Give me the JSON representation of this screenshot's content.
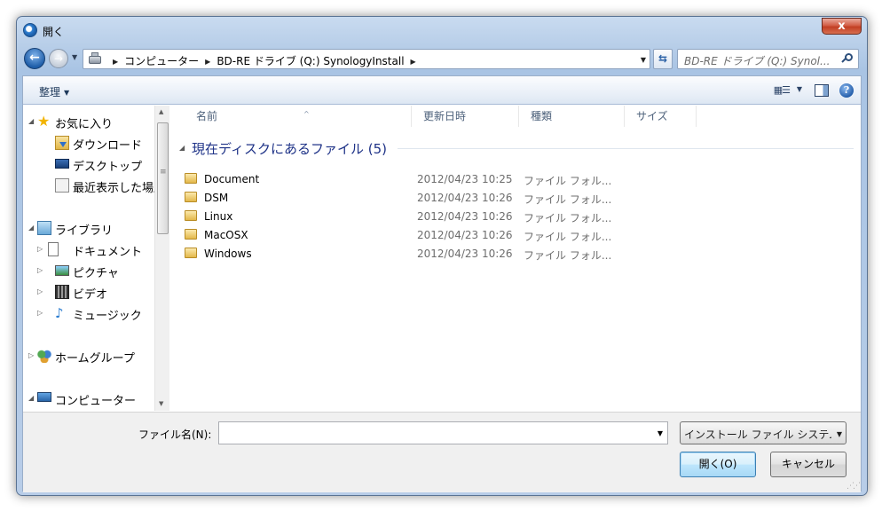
{
  "window": {
    "title": "開く",
    "close_label": "x"
  },
  "nav": {
    "back_label": "←",
    "forward_label": "→",
    "breadcrumbs": [
      "コンピューター",
      "BD-RE ドライブ (Q:) SynologyInstall"
    ],
    "search_placeholder": "BD-RE ドライブ (Q:) Synol..."
  },
  "toolbar": {
    "organize_label": "整理"
  },
  "navpane": {
    "items": [
      {
        "label": "お気に入り",
        "icon": "star-icon"
      },
      {
        "label": "ダウンロード",
        "icon": "downloads-icon"
      },
      {
        "label": "デスクトップ",
        "icon": "desktop-icon"
      },
      {
        "label": "最近表示した場所",
        "icon": "recent-places-icon"
      },
      {
        "label": "ライブラリ",
        "icon": "libraries-icon"
      },
      {
        "label": "ドキュメント",
        "icon": "documents-icon"
      },
      {
        "label": "ピクチャ",
        "icon": "pictures-icon"
      },
      {
        "label": "ビデオ",
        "icon": "videos-icon"
      },
      {
        "label": "ミュージック",
        "icon": "music-icon"
      },
      {
        "label": "ホームグループ",
        "icon": "homegroup-icon"
      },
      {
        "label": "コンピューター",
        "icon": "computer-icon"
      }
    ]
  },
  "filelist": {
    "columns": [
      "名前",
      "更新日時",
      "種類",
      "サイズ"
    ],
    "group_label": "現在ディスクにあるファイル (5)",
    "rows": [
      {
        "name": "Document",
        "date": "2012/04/23 10:25",
        "type": "ファイル フォル..."
      },
      {
        "name": "DSM",
        "date": "2012/04/23 10:26",
        "type": "ファイル フォル..."
      },
      {
        "name": "Linux",
        "date": "2012/04/23 10:26",
        "type": "ファイル フォル..."
      },
      {
        "name": "MacOSX",
        "date": "2012/04/23 10:26",
        "type": "ファイル フォル..."
      },
      {
        "name": "Windows",
        "date": "2012/04/23 10:26",
        "type": "ファイル フォル..."
      }
    ]
  },
  "bottom": {
    "filename_label": "ファイル名(N):",
    "filename_value": "",
    "filter_value": "インストール ファイル システム",
    "open_label": "開く(O)",
    "cancel_label": "キャンセル"
  },
  "colors": {
    "group_header": "#1e3287",
    "accent": "#3c7fb1"
  }
}
